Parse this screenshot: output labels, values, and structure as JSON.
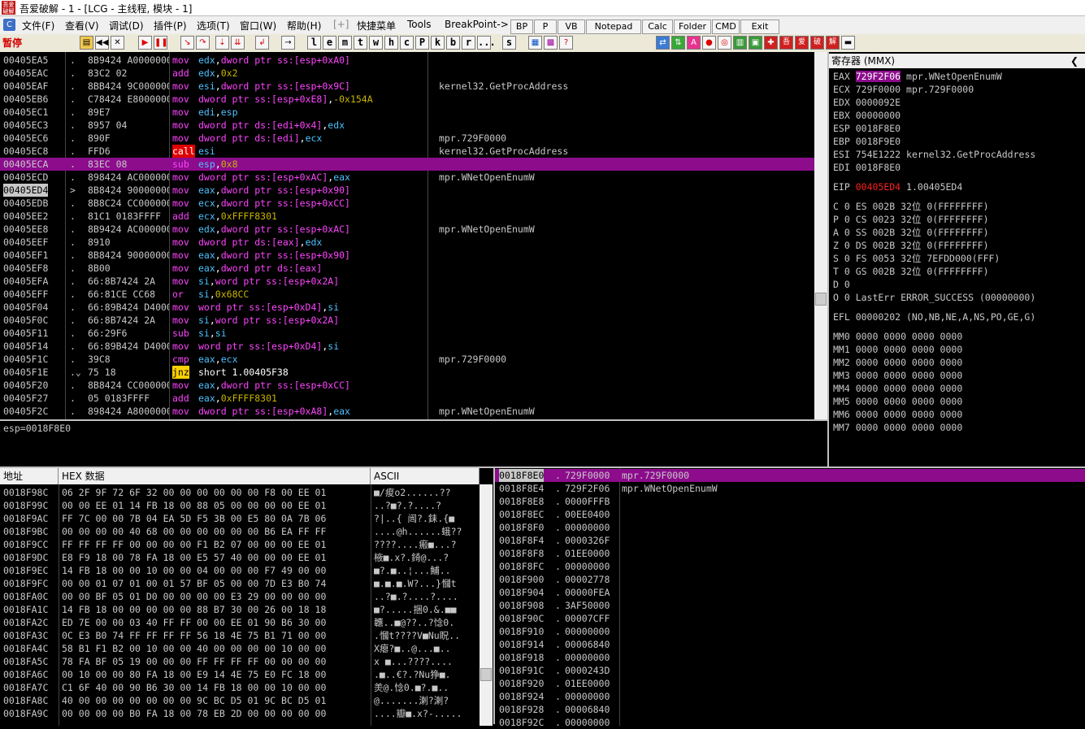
{
  "window": {
    "title": "吾爱破解 - 1 - [LCG - 主线程, 模块 - 1]",
    "logo_text": "吾爱破解"
  },
  "menu": {
    "items": [
      "文件(F)",
      "查看(V)",
      "调试(D)",
      "插件(P)",
      "选项(T)",
      "窗口(W)",
      "帮助(H)",
      "[+]",
      "快捷菜单",
      "Tools",
      "BreakPoint->"
    ],
    "plugin_buttons": [
      "BP",
      "P",
      "VB",
      "Notepad",
      "Calc",
      "Folder",
      "CMD",
      "Exit"
    ]
  },
  "toolbar": {
    "status": "暂停",
    "letter_buttons": [
      "l",
      "e",
      "m",
      "t",
      "w",
      "h",
      "c",
      "P",
      "k",
      "b",
      "r",
      "...",
      "s"
    ],
    "icon_names": [
      "open-icon",
      "rewind-icon",
      "close-icon",
      "run-icon",
      "pause-icon",
      "step-into-icon",
      "step-over-icon",
      "trace-into-icon",
      "trace-over-icon",
      "execute-till-return-icon",
      "goto-icon"
    ],
    "right_text": [
      "吾",
      "爱",
      "破",
      "解"
    ]
  },
  "disasm": {
    "rows": [
      {
        "addr": "00405EA5",
        "mark": ".",
        "hex": "8B9424 A0000000",
        "mn": "mov",
        "mnc": "mov",
        "ops": [
          [
            "edx",
            "reg"
          ],
          [
            ",",
            "txt"
          ],
          [
            "dword ptr ss:[esp+0xA0]",
            "mem"
          ]
        ],
        "cmt": ""
      },
      {
        "addr": "00405EAC",
        "mark": ".",
        "hex": "83C2 02",
        "mn": "add",
        "mnc": "add",
        "ops": [
          [
            "edx",
            "reg"
          ],
          [
            ",",
            "txt"
          ],
          [
            "0x2",
            "num"
          ]
        ],
        "cmt": ""
      },
      {
        "addr": "00405EAF",
        "mark": ".",
        "hex": "8BB424 9C000000",
        "mn": "mov",
        "mnc": "mov",
        "ops": [
          [
            "esi",
            "reg"
          ],
          [
            ",",
            "txt"
          ],
          [
            "dword ptr ss:[esp+0x9C]",
            "mem"
          ]
        ],
        "cmt": "kernel32.GetProcAddress"
      },
      {
        "addr": "00405EB6",
        "mark": ".",
        "hex": "C78424 E8000000",
        "mn": "mov",
        "mnc": "mov",
        "ops": [
          [
            "dword ptr ss:[esp+0xE8]",
            "mem"
          ],
          [
            ",",
            "txt"
          ],
          [
            "-0x154A",
            "num"
          ]
        ],
        "cmt": ""
      },
      {
        "addr": "00405EC1",
        "mark": ".",
        "hex": "89E7",
        "mn": "mov",
        "mnc": "mov",
        "ops": [
          [
            "edi",
            "reg"
          ],
          [
            ",",
            "txt"
          ],
          [
            "esp",
            "reg"
          ]
        ],
        "cmt": ""
      },
      {
        "addr": "00405EC3",
        "mark": ".",
        "hex": "8957 04",
        "mn": "mov",
        "mnc": "mov",
        "ops": [
          [
            "dword ptr ds:[edi+0x4]",
            "mem"
          ],
          [
            ",",
            "txt"
          ],
          [
            "edx",
            "reg"
          ]
        ],
        "cmt": ""
      },
      {
        "addr": "00405EC6",
        "mark": ".",
        "hex": "890F",
        "mn": "mov",
        "mnc": "mov",
        "ops": [
          [
            "dword ptr ds:[edi]",
            "mem"
          ],
          [
            ",",
            "txt"
          ],
          [
            "ecx",
            "reg"
          ]
        ],
        "cmt": "mpr.729F0000"
      },
      {
        "addr": "00405EC8",
        "mark": ".",
        "hex": "FFD6",
        "mn": "call",
        "mnc": "call",
        "ops": [
          [
            "esi",
            "reg"
          ]
        ],
        "cmt": "kernel32.GetProcAddress"
      },
      {
        "addr": "00405ECA",
        "mark": ".",
        "hex": "83EC 08",
        "mn": "sub",
        "mnc": "sub",
        "ops": [
          [
            "esp",
            "reg"
          ],
          [
            ",",
            "txt"
          ],
          [
            "0x8",
            "num"
          ]
        ],
        "cmt": "",
        "hl": true
      },
      {
        "addr": "00405ECD",
        "mark": ".",
        "hex": "898424 AC000000",
        "mn": "mov",
        "mnc": "mov",
        "ops": [
          [
            "dword ptr ss:[esp+0xAC]",
            "mem"
          ],
          [
            ",",
            "txt"
          ],
          [
            "eax",
            "reg"
          ]
        ],
        "cmt": "mpr.WNetOpenEnumW"
      },
      {
        "addr": "00405ED4",
        "mark": ">",
        "hex": "8B8424 90000000",
        "mn": "mov",
        "mnc": "mov",
        "ops": [
          [
            "eax",
            "reg"
          ],
          [
            ",",
            "txt"
          ],
          [
            "dword ptr ss:[esp+0x90]",
            "mem"
          ]
        ],
        "cmt": "",
        "eip": true
      },
      {
        "addr": "00405EDB",
        "mark": ".",
        "hex": "8B8C24 CC000000",
        "mn": "mov",
        "mnc": "mov",
        "ops": [
          [
            "ecx",
            "reg"
          ],
          [
            ",",
            "txt"
          ],
          [
            "dword ptr ss:[esp+0xCC]",
            "mem"
          ]
        ],
        "cmt": ""
      },
      {
        "addr": "00405EE2",
        "mark": ".",
        "hex": "81C1 0183FFFF",
        "mn": "add",
        "mnc": "add",
        "ops": [
          [
            "ecx",
            "reg"
          ],
          [
            ",",
            "txt"
          ],
          [
            "0xFFFF8301",
            "num"
          ]
        ],
        "cmt": ""
      },
      {
        "addr": "00405EE8",
        "mark": ".",
        "hex": "8B9424 AC000000",
        "mn": "mov",
        "mnc": "mov",
        "ops": [
          [
            "edx",
            "reg"
          ],
          [
            ",",
            "txt"
          ],
          [
            "dword ptr ss:[esp+0xAC]",
            "mem"
          ]
        ],
        "cmt": "mpr.WNetOpenEnumW"
      },
      {
        "addr": "00405EEF",
        "mark": ".",
        "hex": "8910",
        "mn": "mov",
        "mnc": "mov",
        "ops": [
          [
            "dword ptr ds:[eax]",
            "mem"
          ],
          [
            ",",
            "txt"
          ],
          [
            "edx",
            "reg"
          ]
        ],
        "cmt": ""
      },
      {
        "addr": "00405EF1",
        "mark": ".",
        "hex": "8B8424 90000000",
        "mn": "mov",
        "mnc": "mov",
        "ops": [
          [
            "eax",
            "reg"
          ],
          [
            ",",
            "txt"
          ],
          [
            "dword ptr ss:[esp+0x90]",
            "mem"
          ]
        ],
        "cmt": ""
      },
      {
        "addr": "00405EF8",
        "mark": ".",
        "hex": "8B00",
        "mn": "mov",
        "mnc": "mov",
        "ops": [
          [
            "eax",
            "reg"
          ],
          [
            ",",
            "txt"
          ],
          [
            "dword ptr ds:[eax]",
            "mem"
          ]
        ],
        "cmt": ""
      },
      {
        "addr": "00405EFA",
        "mark": ".",
        "hex": "66:8B7424 2A",
        "mn": "mov",
        "mnc": "mov",
        "ops": [
          [
            "si",
            "reg"
          ],
          [
            ",",
            "txt"
          ],
          [
            "word ptr ss:[esp+0x2A]",
            "mem"
          ]
        ],
        "cmt": ""
      },
      {
        "addr": "00405EFF",
        "mark": ".",
        "hex": "66:81CE CC68",
        "mn": "or",
        "mnc": "or",
        "ops": [
          [
            "si",
            "reg"
          ],
          [
            ",",
            "txt"
          ],
          [
            "0x68CC",
            "num"
          ]
        ],
        "cmt": ""
      },
      {
        "addr": "00405F04",
        "mark": ".",
        "hex": "66:89B424 D4000000",
        "mn": "mov",
        "mnc": "mov",
        "ops": [
          [
            "word ptr ss:[esp+0xD4]",
            "mem"
          ],
          [
            ",",
            "txt"
          ],
          [
            "si",
            "reg"
          ]
        ],
        "cmt": ""
      },
      {
        "addr": "00405F0C",
        "mark": ".",
        "hex": "66:8B7424 2A",
        "mn": "mov",
        "mnc": "mov",
        "ops": [
          [
            "si",
            "reg"
          ],
          [
            ",",
            "txt"
          ],
          [
            "word ptr ss:[esp+0x2A]",
            "mem"
          ]
        ],
        "cmt": ""
      },
      {
        "addr": "00405F11",
        "mark": ".",
        "hex": "66:29F6",
        "mn": "sub",
        "mnc": "sub",
        "ops": [
          [
            "si",
            "reg"
          ],
          [
            ",",
            "txt"
          ],
          [
            "si",
            "reg"
          ]
        ],
        "cmt": ""
      },
      {
        "addr": "00405F14",
        "mark": ".",
        "hex": "66:89B424 D4000000",
        "mn": "mov",
        "mnc": "mov",
        "ops": [
          [
            "word ptr ss:[esp+0xD4]",
            "mem"
          ],
          [
            ",",
            "txt"
          ],
          [
            "si",
            "reg"
          ]
        ],
        "cmt": ""
      },
      {
        "addr": "00405F1C",
        "mark": ".",
        "hex": "39C8",
        "mn": "cmp",
        "mnc": "cmp",
        "ops": [
          [
            "eax",
            "reg"
          ],
          [
            ",",
            "txt"
          ],
          [
            "ecx",
            "reg"
          ]
        ],
        "cmt": "mpr.729F0000"
      },
      {
        "addr": "00405F1E",
        "mark": ".⌄",
        "hex": "75 18",
        "mn": "jnz",
        "mnc": "jnz",
        "ops": [
          [
            "short 1.00405F38",
            "txt"
          ]
        ],
        "cmt": ""
      },
      {
        "addr": "00405F20",
        "mark": ".",
        "hex": "8B8424 CC000000",
        "mn": "mov",
        "mnc": "mov",
        "ops": [
          [
            "eax",
            "reg"
          ],
          [
            ",",
            "txt"
          ],
          [
            "dword ptr ss:[esp+0xCC]",
            "mem"
          ]
        ],
        "cmt": ""
      },
      {
        "addr": "00405F27",
        "mark": ".",
        "hex": "05 0183FFFF",
        "mn": "add",
        "mnc": "add",
        "ops": [
          [
            "eax",
            "reg"
          ],
          [
            ",",
            "txt"
          ],
          [
            "0xFFFF8301",
            "num"
          ]
        ],
        "cmt": ""
      },
      {
        "addr": "00405F2C",
        "mark": ".",
        "hex": "898424 A8000000",
        "mn": "mov",
        "mnc": "mov",
        "ops": [
          [
            "dword ptr ss:[esp+0xA8]",
            "mem"
          ],
          [
            ",",
            "txt"
          ],
          [
            "eax",
            "reg"
          ]
        ],
        "cmt": "mpr.WNetOpenEnumW"
      }
    ]
  },
  "info": {
    "text": "esp=0018F8E0"
  },
  "registers": {
    "title": "寄存器 (MMX)",
    "gp": [
      {
        "name": "EAX",
        "val": "729F2F06",
        "note": "mpr.WNetOpenEnumW",
        "hl": true
      },
      {
        "name": "ECX",
        "val": "729F0000",
        "note": "mpr.729F0000"
      },
      {
        "name": "EDX",
        "val": "0000092E",
        "note": ""
      },
      {
        "name": "EBX",
        "val": "00000000",
        "note": ""
      },
      {
        "name": "ESP",
        "val": "0018F8E0",
        "note": ""
      },
      {
        "name": "EBP",
        "val": "0018F9E0",
        "note": ""
      },
      {
        "name": "ESI",
        "val": "754E1222",
        "note": "kernel32.GetProcAddress"
      },
      {
        "name": "EDI",
        "val": "0018F8E0",
        "note": ""
      }
    ],
    "eip": {
      "name": "EIP",
      "val": "00405ED4",
      "note": "1.00405ED4"
    },
    "flags": [
      "C 0  ES 002B 32位 0(FFFFFFFF)",
      "P 0  CS 0023 32位 0(FFFFFFFF)",
      "A 0  SS 002B 32位 0(FFFFFFFF)",
      "Z 0  DS 002B 32位 0(FFFFFFFF)",
      "S 0  FS 0053 32位 7EFDD000(FFF)",
      "T 0  GS 002B 32位 0(FFFFFFFF)",
      "D 0",
      "O 0  LastErr ERROR_SUCCESS (00000000)"
    ],
    "efl": "EFL 00000202 (NO,NB,NE,A,NS,PO,GE,G)",
    "mmx": [
      "MM0 0000 0000 0000 0000",
      "MM1 0000 0000 0000 0000",
      "MM2 0000 0000 0000 0000",
      "MM3 0000 0000 0000 0000",
      "MM4 0000 0000 0000 0000",
      "MM5 0000 0000 0000 0000",
      "MM6 0000 0000 0000 0000",
      "MM7 0000 0000 0000 0000"
    ]
  },
  "dump": {
    "headers": {
      "addr": "地址",
      "hex": "HEX 数据",
      "ascii": "ASCII"
    },
    "rows": [
      {
        "addr": "0018F98C",
        "hex": "06 2F 9F 72 6F 32 00 00 00 00 00 00 F8 00 EE 01",
        "asc": "■/痠o2......??"
      },
      {
        "addr": "0018F99C",
        "hex": "00 00 EE 01 14 FB 18 00 88 05 00 00 00 00 EE 01",
        "asc": "..?■?.?....?"
      },
      {
        "addr": "0018F9AC",
        "hex": "FF 7C 00 00 7B 04 EA 5D F5 3B 00 E5 80 0A 7B 06",
        "asc": "?|..{ 闿?.銇.{■"
      },
      {
        "addr": "0018F9BC",
        "hex": "00 00 00 00 40 68 00 00 00 00 00 00 B6 EA FF FF",
        "asc": "....@h......蛾??"
      },
      {
        "addr": "0018F9CC",
        "hex": "FF FF FF FF 00 00 00 00 F1 B2 07 00 00 00 EE 01",
        "asc": "????....瘢■...?"
      },
      {
        "addr": "0018F9DC",
        "hex": "E8 F9 18 00 78 FA 18 00 E5 57 40 00 00 00 EE 01",
        "asc": "棭■.x?.錡@...?"
      },
      {
        "addr": "0018F9EC",
        "hex": "14 FB 18 00 00 10 00 00 04 00 00 00 F7 49 00 00",
        "asc": "■?.■..¦...鯆.."
      },
      {
        "addr": "0018F9FC",
        "hex": "00 00 01 07 01 00 01 57 BF 05 00 00 7D E3 B0 74",
        "asc": "■.■.■.W?...}慖t"
      },
      {
        "addr": "0018FA0C",
        "hex": "00 00 BF 05 01 D0 00 00 00 00 E3 29 00 00 00 00",
        "asc": "..?■.?....?...."
      },
      {
        "addr": "0018FA1C",
        "hex": "14 FB 18 00 00 00 00 00 88 B7 30 00 26 00 18 18",
        "asc": "■?.....捆0.&.■■"
      },
      {
        "addr": "0018FA2C",
        "hex": "ED 7E 00 00 03 40 FF FF 00 00 EE 01 90 B6 30 00",
        "asc": "韢..■@??..?惗0."
      },
      {
        "addr": "0018FA3C",
        "hex": "0C E3 B0 74 FF FF FF FF 56 18 4E 75 B1 71 00 00",
        "asc": ".慖t????V■Nu眖.."
      },
      {
        "addr": "0018FA4C",
        "hex": "58 B1 F1 B2 00 10 00 00 40 00 00 00 00 10 00 00",
        "asc": "X瘪?■..@...■.."
      },
      {
        "addr": "0018FA5C",
        "hex": "78 FA BF 05 19 00 00 00 FF FF FF FF 00 00 00 00",
        "asc": "x ■...????...."
      },
      {
        "addr": "0018FA6C",
        "hex": "00 10 00 00 80 FA 18 00 E9 14 4E 75 E0 FC 18 00",
        "asc": ".■..€?.?Nu狰■."
      },
      {
        "addr": "0018FA7C",
        "hex": "C1 6F 40 00 90 B6 30 00 14 FB 18 00 00 10 00 00",
        "asc": "羙@.惗0.■?.■.."
      },
      {
        "addr": "0018FA8C",
        "hex": "40 00 00 00 00 00 00 00 9C BC D5 01 9C BC D5 01",
        "asc": "@.......溂?溂?"
      },
      {
        "addr": "0018FA9C",
        "hex": "00 00 00 00 B0 FA 18 00 78 EB 2D 00 00 00 00 00",
        "asc": "....瓣■.x?-....."
      }
    ]
  },
  "stack": {
    "rows": [
      {
        "addr": "0018F8E0",
        "val": "729F0000",
        "cmt": "mpr.729F0000",
        "hl": true
      },
      {
        "addr": "0018F8E4",
        "val": "729F2F06",
        "cmt": "mpr.WNetOpenEnumW"
      },
      {
        "addr": "0018F8E8",
        "val": "0000FFFB",
        "cmt": ""
      },
      {
        "addr": "0018F8EC",
        "val": "00EE0400",
        "cmt": ""
      },
      {
        "addr": "0018F8F0",
        "val": "00000000",
        "cmt": ""
      },
      {
        "addr": "0018F8F4",
        "val": "0000326F",
        "cmt": ""
      },
      {
        "addr": "0018F8F8",
        "val": "01EE0000",
        "cmt": ""
      },
      {
        "addr": "0018F8FC",
        "val": "00000000",
        "cmt": ""
      },
      {
        "addr": "0018F900",
        "val": "00002778",
        "cmt": ""
      },
      {
        "addr": "0018F904",
        "val": "00000FEA",
        "cmt": ""
      },
      {
        "addr": "0018F908",
        "val": "3AF50000",
        "cmt": ""
      },
      {
        "addr": "0018F90C",
        "val": "00007CFF",
        "cmt": ""
      },
      {
        "addr": "0018F910",
        "val": "00000000",
        "cmt": ""
      },
      {
        "addr": "0018F914",
        "val": "00006840",
        "cmt": ""
      },
      {
        "addr": "0018F918",
        "val": "00000000",
        "cmt": ""
      },
      {
        "addr": "0018F91C",
        "val": "0000243D",
        "cmt": ""
      },
      {
        "addr": "0018F920",
        "val": "01EE0000",
        "cmt": ""
      },
      {
        "addr": "0018F924",
        "val": "00000000",
        "cmt": ""
      },
      {
        "addr": "0018F928",
        "val": "00006840",
        "cmt": ""
      },
      {
        "addr": "0018F92C",
        "val": "00000000",
        "cmt": ""
      }
    ]
  }
}
